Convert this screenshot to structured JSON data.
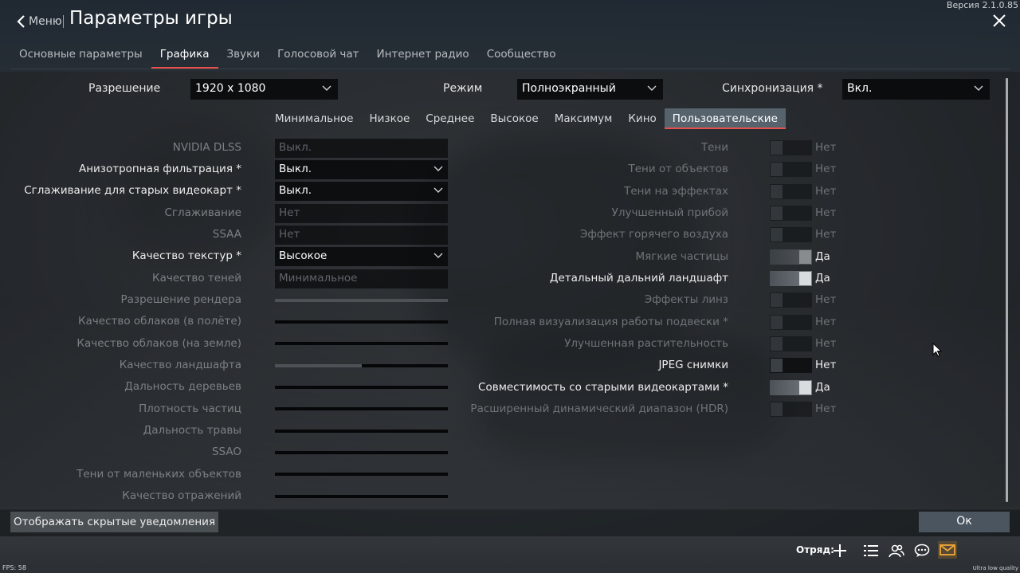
{
  "header": {
    "back_label": "Меню",
    "title": "Параметры игры",
    "version": "Версия 2.1.0.85"
  },
  "tabs": [
    {
      "label": "Основные параметры",
      "active": false
    },
    {
      "label": "Графика",
      "active": true
    },
    {
      "label": "Звуки",
      "active": false
    },
    {
      "label": "Голосовой чат",
      "active": false
    },
    {
      "label": "Интернет радио",
      "active": false
    },
    {
      "label": "Сообщество",
      "active": false
    }
  ],
  "top_settings": {
    "resolution": {
      "label": "Разрешение",
      "value": "1920 x 1080"
    },
    "mode": {
      "label": "Режим",
      "value": "Полноэкранный"
    },
    "vsync": {
      "label": "Синхронизация *",
      "value": "Вкл."
    }
  },
  "presets": [
    {
      "label": "Минимальное",
      "active": false
    },
    {
      "label": "Низкое",
      "active": false
    },
    {
      "label": "Среднее",
      "active": false
    },
    {
      "label": "Высокое",
      "active": false
    },
    {
      "label": "Максимум",
      "active": false
    },
    {
      "label": "Кино",
      "active": false
    },
    {
      "label": "Пользовательские",
      "active": true
    }
  ],
  "left_settings": {
    "dlss": {
      "label": "NVIDIA DLSS",
      "value": "Выкл."
    },
    "aniso": {
      "label": "Анизотропная фильтрация *",
      "value": "Выкл."
    },
    "aa_old": {
      "label": "Сглаживание для старых видеокарт *",
      "value": "Выкл."
    },
    "aa": {
      "label": "Сглаживание",
      "value": "Нет"
    },
    "ssaa": {
      "label": "SSAA",
      "value": "Нет"
    },
    "textures": {
      "label": "Качество текстур *",
      "value": "Высокое"
    },
    "shadows_q": {
      "label": "Качество теней",
      "value": "Минимальное"
    },
    "render_res": {
      "label": "Разрешение рендера",
      "level": 1.0
    },
    "clouds_air": {
      "label": "Качество облаков (в полёте)",
      "level": 0.0
    },
    "clouds_ground": {
      "label": "Качество облаков (на земле)",
      "level": 0.0
    },
    "landscape": {
      "label": "Качество ландшафта",
      "level": 0.5
    },
    "trees": {
      "label": "Дальность деревьев",
      "level": 0.0
    },
    "particles": {
      "label": "Плотность частиц",
      "level": 0.0
    },
    "grass": {
      "label": "Дальность травы",
      "level": 0.0
    },
    "ssao": {
      "label": "SSAO",
      "level": 0.0
    },
    "small_shadows": {
      "label": "Тени от маленьких объектов",
      "level": 0.0
    },
    "reflections": {
      "label": "Качество отражений",
      "level": 0.0
    }
  },
  "right_settings": [
    {
      "label": "Тени",
      "value": "Нет"
    },
    {
      "label": "Тени от объектов",
      "value": "Нет"
    },
    {
      "label": "Тени на эффектах",
      "value": "Нет"
    },
    {
      "label": "Улучшенный прибой",
      "value": "Нет"
    },
    {
      "label": "Эффект горячего воздуха",
      "value": "Нет"
    },
    {
      "label": "Мягкие частицы",
      "value": "Да"
    },
    {
      "label": "Детальный дальний ландшафт",
      "value": "Да"
    },
    {
      "label": "Эффекты линз",
      "value": "Нет"
    },
    {
      "label": "Полная визуализация работы подвески *",
      "value": "Нет"
    },
    {
      "label": "Улучшенная растительность",
      "value": "Нет"
    },
    {
      "label": "JPEG снимки",
      "value": "Нет"
    },
    {
      "label": "Совместимость со старыми видеокартами *",
      "value": "Да"
    },
    {
      "label": "Расширенный динамический диапазон (HDR)",
      "value": "Нет"
    }
  ],
  "bottom": {
    "show_hidden_label": "Отображать скрытые уведомления",
    "ok_label": "Ок",
    "squad_label": "Отряд:",
    "fps": "FPS: 58",
    "quality": "Ultra low quality"
  },
  "icons": [
    "chevron-left-icon",
    "close-icon",
    "chevron-down-icon",
    "plus-icon",
    "list-icon",
    "contacts-icon",
    "chat-icon",
    "mail-icon",
    "mouse-cursor-icon"
  ]
}
